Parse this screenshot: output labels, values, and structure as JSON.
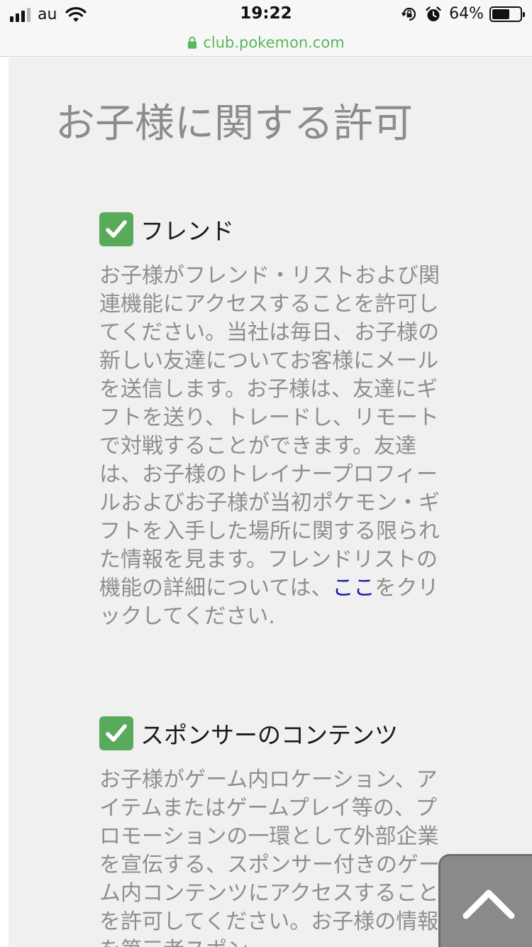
{
  "status_bar": {
    "carrier": "au",
    "time": "19:22",
    "battery": "64%",
    "battery_level": 0.64,
    "icons": [
      "signal-icon",
      "wifi-icon",
      "orientation-lock-icon",
      "alarm-icon",
      "battery-icon"
    ]
  },
  "browser": {
    "url": "club.pokemon.com",
    "url_color": "#59b75a"
  },
  "page": {
    "title": "お子様に関する許可",
    "sections": [
      {
        "checked": true,
        "title": "フレンド",
        "description_before_link": "お子様がフレンド・リストおよび関連機能にアクセスすることを許可してください。当社は毎日、お子様の新しい友達についてお客様にメールを送信します。お子様は、友達にギフトを送り、トレードし、リモートで対戦することができます。友達は、お子様のトレイナープロフィールおよびお子様が当初ポケモン・ギフトを入手した場所に関する限られた情報を見ます。フレンドリストの機能の詳細については、",
        "link_text": "ここ",
        "description_after_link": "をクリックしてください."
      },
      {
        "checked": true,
        "title": "スポンサーのコンテンツ",
        "description": "お子様がゲーム内ロケーション、アイテムまたはゲームプレイ等の、プロモーションの一環として外部企業を宣伝する、スポンサー付きのゲーム内コンテンツにアクセスすることを許可してください。お子様の情報を第三者スポン"
      }
    ]
  },
  "colors": {
    "checkbox": "#5aaa5c",
    "panel_bg": "#f0f0f0",
    "link": "#1a1aa6",
    "scroll_button": "#8a8a8a"
  }
}
